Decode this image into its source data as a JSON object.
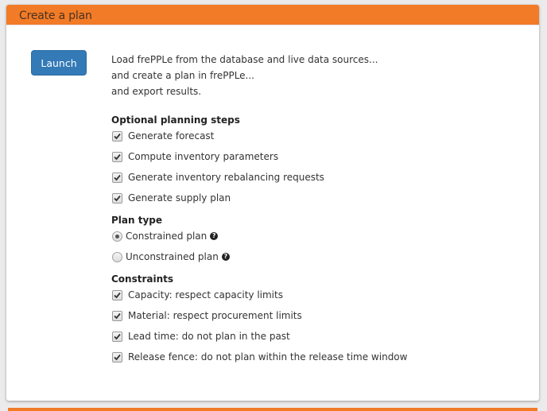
{
  "panel": {
    "title": "Create a plan",
    "header_color": "#f27b27"
  },
  "launch_button": {
    "label": "Launch",
    "color": "#337ab7"
  },
  "description": [
    "Load frePPLe from the database and live data sources...",
    "and create a plan in frePPLe...",
    "and export results."
  ],
  "optional_steps": {
    "title": "Optional planning steps",
    "items": [
      {
        "label": "Generate forecast",
        "checked": true
      },
      {
        "label": "Compute inventory parameters",
        "checked": true
      },
      {
        "label": "Generate inventory rebalancing requests",
        "checked": true
      },
      {
        "label": "Generate supply plan",
        "checked": true
      }
    ]
  },
  "plan_type": {
    "title": "Plan type",
    "options": [
      {
        "label": "Constrained plan",
        "selected": true,
        "help_icon": "question-circle-icon"
      },
      {
        "label": "Unconstrained plan",
        "selected": false,
        "help_icon": "question-circle-icon"
      }
    ]
  },
  "constraints": {
    "title": "Constraints",
    "items": [
      {
        "label": "Capacity: respect capacity limits",
        "checked": true
      },
      {
        "label": "Material: respect procurement limits",
        "checked": true
      },
      {
        "label": "Lead time: do not plan in the past",
        "checked": true
      },
      {
        "label": "Release fence: do not plan within the release time window",
        "checked": true
      }
    ]
  }
}
